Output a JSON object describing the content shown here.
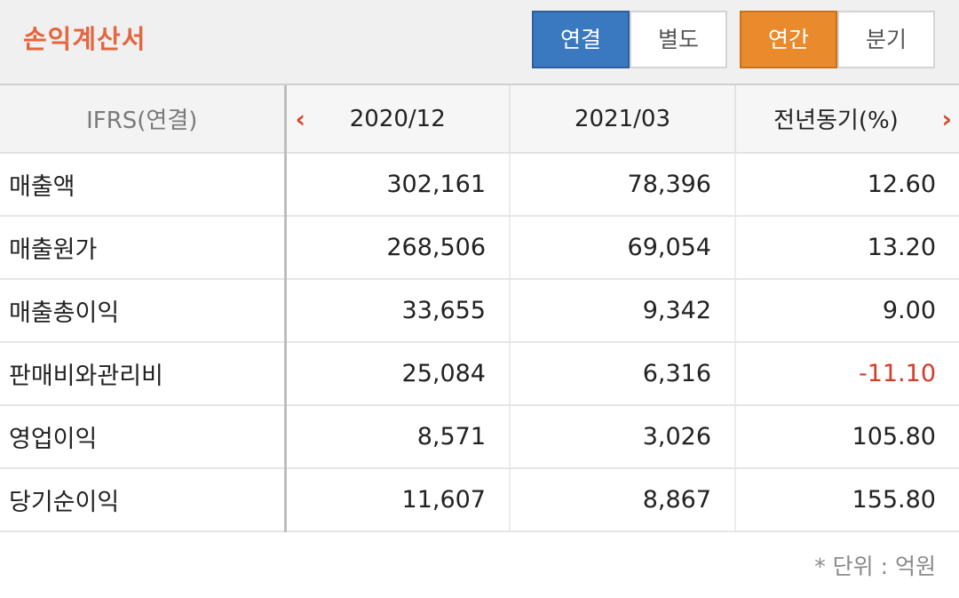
{
  "header": {
    "title": "손익계산서",
    "consolidation_tabs": [
      {
        "label": "연결",
        "active": true
      },
      {
        "label": "별도",
        "active": false
      }
    ],
    "period_tabs": [
      {
        "label": "연간",
        "active": true
      },
      {
        "label": "분기",
        "active": false
      }
    ]
  },
  "table": {
    "columns": [
      "IFRS(연결)",
      "2020/12",
      "2021/03",
      "전년동기(%)"
    ],
    "rows": [
      {
        "label": "매출액",
        "values": [
          "302,161",
          "78,396",
          "12.60"
        ]
      },
      {
        "label": "매출원가",
        "values": [
          "268,506",
          "69,054",
          "13.20"
        ]
      },
      {
        "label": "매출총이익",
        "values": [
          "33,655",
          "9,342",
          "9.00"
        ]
      },
      {
        "label": "판매비와관리비",
        "values": [
          "25,084",
          "6,316",
          "-11.10"
        ]
      },
      {
        "label": "영업이익",
        "values": [
          "8,571",
          "3,026",
          "105.80"
        ]
      },
      {
        "label": "당기순이익",
        "values": [
          "11,607",
          "8,867",
          "155.80"
        ]
      }
    ]
  },
  "footnote": "* 단위 : 억원",
  "colors": {
    "title": "#e4663f",
    "active_blue": "#3a78c0",
    "active_orange": "#e98a2c",
    "negative": "#d63a2a",
    "arrow": "#d6492d"
  },
  "icons": {
    "prev": "chevron-left-icon",
    "next": "chevron-right-icon"
  }
}
